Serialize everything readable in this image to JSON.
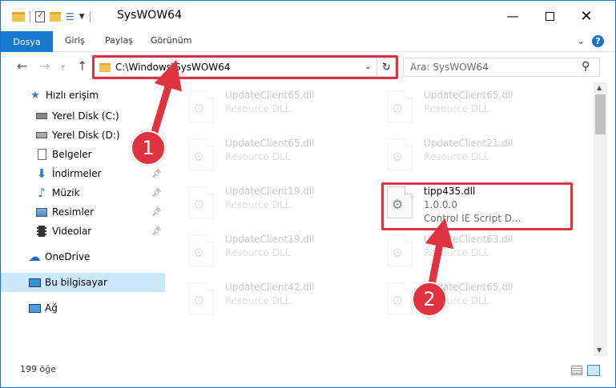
{
  "window": {
    "title": "SysWOW64"
  },
  "ribbon": {
    "tabs": [
      "Dosya",
      "Giriş",
      "Paylaş",
      "Görünüm"
    ]
  },
  "navbar": {
    "address": "C:\\Windows\\SysWOW64",
    "search_placeholder": "Ara: SysWOW64"
  },
  "sidebar": {
    "items": [
      {
        "label": "Hızlı erişim",
        "icon": "star-icon"
      },
      {
        "label": "Yerel Disk (C:)",
        "icon": "drive-icon"
      },
      {
        "label": "Yerel Disk (D:)",
        "icon": "drive-icon"
      },
      {
        "label": "Belgeler",
        "icon": "document-icon"
      },
      {
        "label": "İndirmeler",
        "icon": "download-icon"
      },
      {
        "label": "Müzik",
        "icon": "music-icon"
      },
      {
        "label": "Resimler",
        "icon": "pictures-icon"
      },
      {
        "label": "Videolar",
        "icon": "video-icon"
      },
      {
        "label": "OneDrive",
        "icon": "cloud-icon"
      },
      {
        "label": "Bu bilgisayar",
        "icon": "computer-icon"
      },
      {
        "label": "Ağ",
        "icon": "network-icon"
      }
    ],
    "selected": "Bu bilgisayar"
  },
  "files": [
    {
      "name": "UpdateClient65.dll",
      "line2": "Resource DLL"
    },
    {
      "name": "UpdateClient65.dll",
      "line2": "Resource DLL"
    },
    {
      "name": "UpdateClient65.dll",
      "line2": "Resource DLL"
    },
    {
      "name": "UpdateClient21.dll",
      "line2": "Resource DLL"
    },
    {
      "name": "UpdateClient19.dll",
      "line2": "Resource DLL"
    },
    {
      "name": "tipp435.dll",
      "line2": "1.0.0.0",
      "line3": "Control IE Script D..."
    },
    {
      "name": "UpdateClient19.dll",
      "line2": "Resource DLL"
    },
    {
      "name": "UpdateClient63.dll",
      "line2": "Resource DLL"
    },
    {
      "name": "UpdateClient42.dll",
      "line2": "Resource DLL"
    },
    {
      "name": "UpdateClient65.dll",
      "line2": "Resource DLL"
    }
  ],
  "status": {
    "item_count": "199 öğe"
  },
  "annotations": {
    "badge_1": "1",
    "badge_2": "2",
    "color": "#e0333f"
  },
  "colors": {
    "accent": "#1979ca",
    "selection": "#cce8ff"
  }
}
